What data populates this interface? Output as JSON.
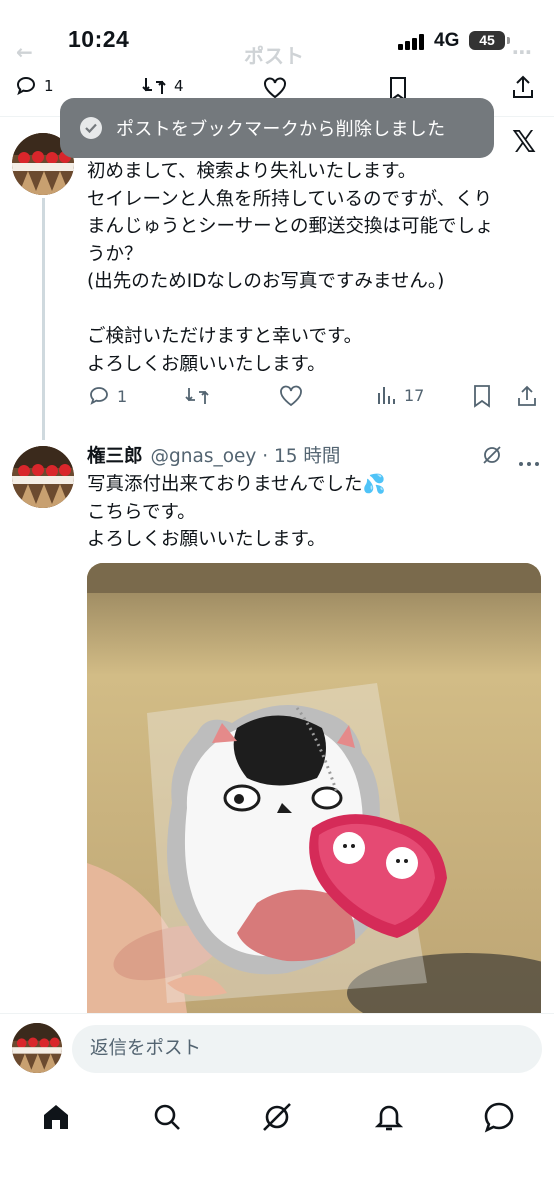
{
  "status_bar": {
    "time": "10:24",
    "network": "4G",
    "battery": "45"
  },
  "header": {
    "title_faint": "ポスト"
  },
  "prev_tweet_actions": {
    "replies": "1",
    "retweets": "4"
  },
  "toast": {
    "message": "ポストをブックマークから削除しました"
  },
  "tweet1": {
    "text": "初めまして、検索より失礼いたします。\nセイレーンと人魚を所持しているのですが、くり\nまんじゅうとシーサーとの郵送交換は可能でしょ\nうか？\n(出先のためIDなしのお写真ですみません。)\n\nご検討いただけますと幸いです。\nよろしくお願いいたします。",
    "replies": "1",
    "views": "17"
  },
  "tweet2": {
    "author": "権三郎",
    "handle_time": "@gnas_oey · 15 時間",
    "text": "写真添付出来ておりませんでした💦\nこちらです。\nよろしくお願いいたします。"
  },
  "reply_bar": {
    "placeholder": "返信をポスト"
  },
  "icons": {
    "reply": "reply-icon",
    "retweet": "retweet-icon",
    "like": "heart-icon",
    "views": "views-icon",
    "bookmark": "bookmark-icon",
    "share": "share-icon",
    "home": "home-icon",
    "search": "search-icon",
    "grok": "grok-icon",
    "notifications": "bell-icon",
    "messages": "messages-icon"
  },
  "colors": {
    "toast_bg": "#74797d",
    "muted_text": "#536471",
    "thread_line": "#cfd9de"
  }
}
